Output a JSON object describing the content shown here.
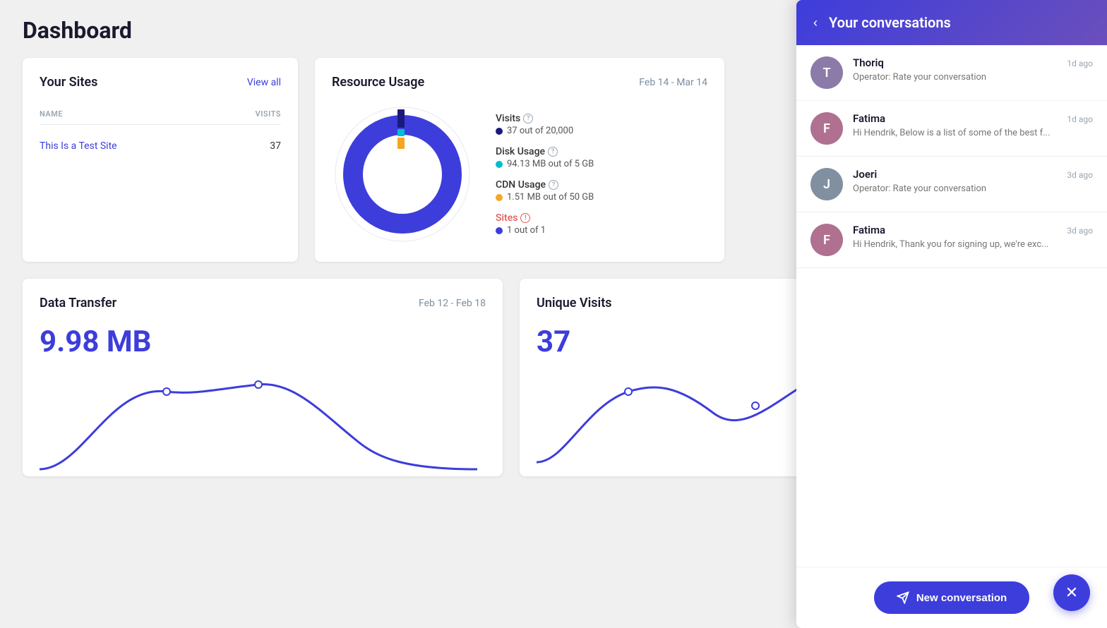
{
  "page": {
    "title": "Dashboard"
  },
  "your_sites": {
    "title": "Your Sites",
    "view_all": "View all",
    "columns": {
      "name": "NAME",
      "visits": "VISITS"
    },
    "rows": [
      {
        "name": "This Is a Test Site",
        "visits": "37"
      }
    ]
  },
  "resource_usage": {
    "title": "Resource Usage",
    "date_range": "Feb 14 - Mar 14",
    "stats": [
      {
        "label": "Visits",
        "value": "37 out of 20,000",
        "color": "#1a1a7c",
        "has_help": true,
        "red": false
      },
      {
        "label": "Disk Usage",
        "value": "94.13 MB out of 5 GB",
        "color": "#00bcd4",
        "has_help": true,
        "red": false
      },
      {
        "label": "CDN Usage",
        "value": "1.51 MB out of 50 GB",
        "color": "#f5a623",
        "has_help": true,
        "red": false
      },
      {
        "label": "Sites",
        "value": "1 out of 1",
        "color": "#3d3ddc",
        "has_help": true,
        "red": true
      }
    ]
  },
  "data_transfer": {
    "title": "Data Transfer",
    "date_range": "Feb 12 - Feb 18",
    "value": "9.98 MB"
  },
  "unique_visits": {
    "title": "Unique Visits",
    "value": "37"
  },
  "conversations": {
    "panel_title": "Your conversations",
    "back_icon": "‹",
    "items": [
      {
        "name": "Thoriq",
        "time": "1d ago",
        "preview": "Operator: Rate your conversation",
        "avatar_letter": "T",
        "avatar_color": "#8b7ba8"
      },
      {
        "name": "Fatima",
        "time": "1d ago",
        "preview": "Hi Hendrik, Below is a list of some of the best f...",
        "avatar_letter": "F",
        "avatar_color": "#b07090"
      },
      {
        "name": "Joeri",
        "time": "3d ago",
        "preview": "Operator: Rate your conversation",
        "avatar_letter": "J",
        "avatar_color": "#8090a0"
      },
      {
        "name": "Fatima",
        "time": "3d ago",
        "preview": "Hi Hendrik, Thank you for signing up, we're exc...",
        "avatar_letter": "F",
        "avatar_color": "#b07090"
      }
    ],
    "new_conversation_label": "New conversation"
  }
}
